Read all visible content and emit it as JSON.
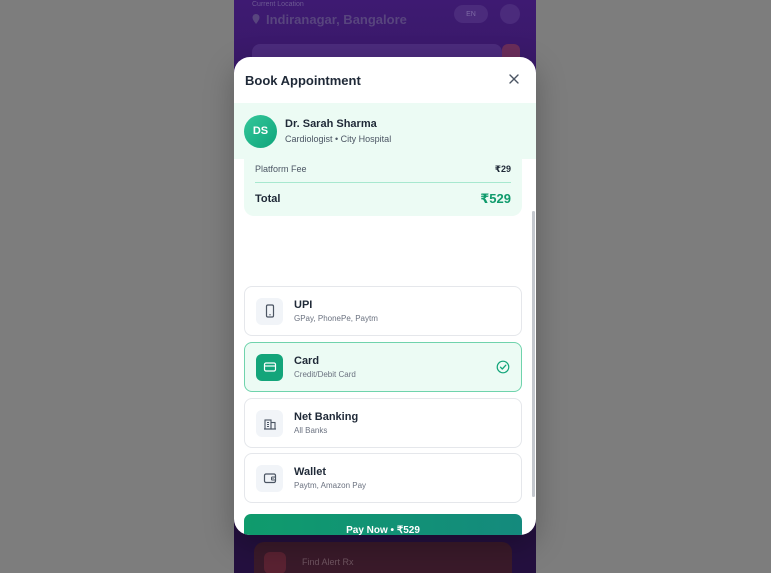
{
  "background": {
    "location_hint": "Current Location",
    "location": "Indiranagar, Bangalore",
    "chip": "EN",
    "card_text": "Find Alert Rx"
  },
  "modal": {
    "title": "Book Appointment",
    "close_icon": "close-icon"
  },
  "doctor": {
    "initials": "DS",
    "name": "Dr. Sarah Sharma",
    "subtitle": "Cardiologist • City Hospital"
  },
  "summary": {
    "platform_fee_label": "Platform Fee",
    "platform_fee_value": "₹29",
    "total_label": "Total",
    "total_value": "₹529"
  },
  "payment_methods": [
    {
      "label": "UPI",
      "sub": "GPay, PhonePe, Paytm",
      "icon": "phone-icon",
      "selected": false
    },
    {
      "label": "Card",
      "sub": "Credit/Debit Card",
      "icon": "credit-card-icon",
      "selected": true
    },
    {
      "label": "Net Banking",
      "sub": "All Banks",
      "icon": "bank-building-icon",
      "selected": false
    },
    {
      "label": "Wallet",
      "sub": "Paytm, Amazon Pay",
      "icon": "wallet-icon",
      "selected": false
    }
  ],
  "pay_button": "Pay Now • ₹529",
  "colors": {
    "accent": "#0f9b6c",
    "accent_light": "#ecfbf4",
    "selected_border": "#6fd3ac",
    "overlay": "#7d7d7d",
    "header_purple": "#3e1a72"
  }
}
